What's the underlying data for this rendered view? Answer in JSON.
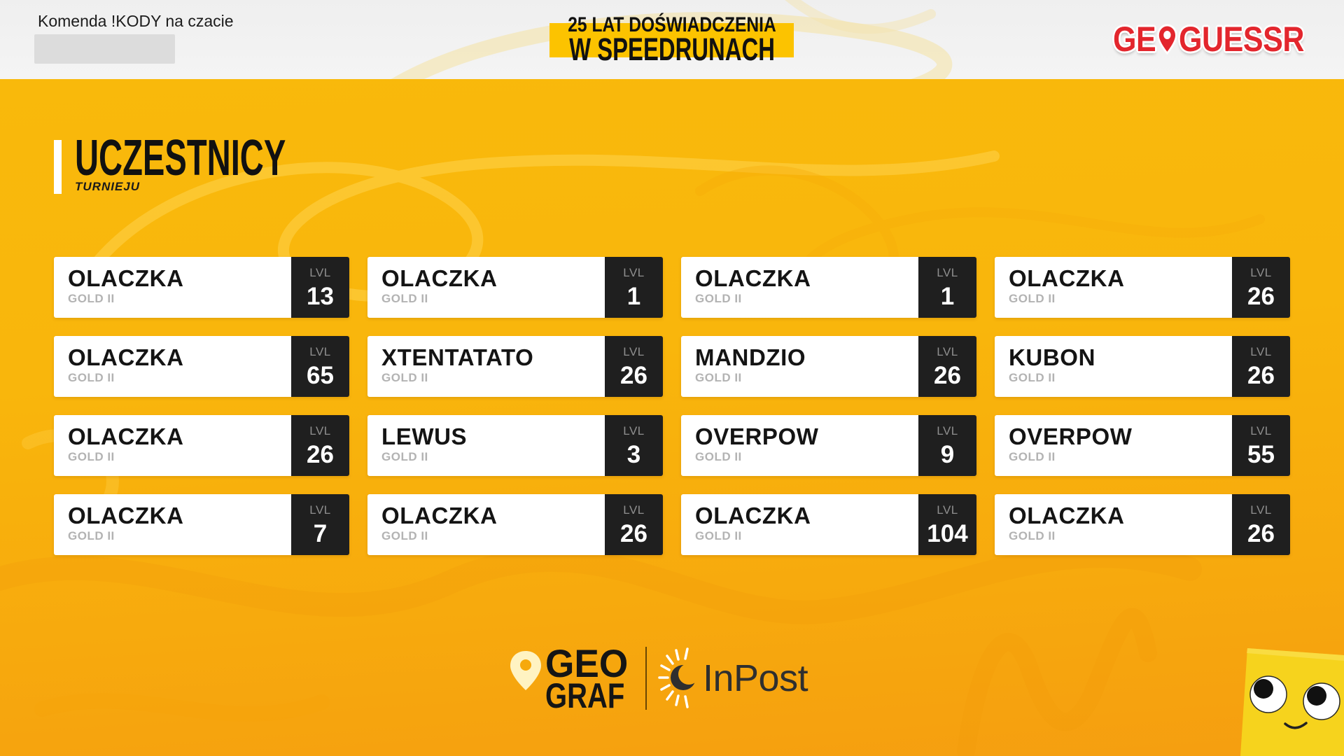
{
  "top_bar": {
    "chat_command": "Komenda !KODY na czacie",
    "banner": {
      "line1": "25 LAT DOŚWIADCZENIA",
      "line2": "W SPEEDRUNACH"
    },
    "brand_logo": {
      "left": "GE",
      "icon": "location-pin-icon",
      "right": "GUESSR"
    }
  },
  "section": {
    "title": "UCZESTNICY",
    "subtitle": "TURNIEJU"
  },
  "participants": [
    {
      "name": "OLACZKA",
      "rank": "GOLD II",
      "level_label": "LVL",
      "level": 13
    },
    {
      "name": "OLACZKA",
      "rank": "GOLD II",
      "level_label": "LVL",
      "level": 1
    },
    {
      "name": "OLACZKA",
      "rank": "GOLD II",
      "level_label": "LVL",
      "level": 1
    },
    {
      "name": "OLACZKA",
      "rank": "GOLD II",
      "level_label": "LVL",
      "level": 26
    },
    {
      "name": "OLACZKA",
      "rank": "GOLD II",
      "level_label": "LVL",
      "level": 65
    },
    {
      "name": "XTENTATATO",
      "rank": "GOLD II",
      "level_label": "LVL",
      "level": 26
    },
    {
      "name": "MANDZIO",
      "rank": "GOLD II",
      "level_label": "LVL",
      "level": 26
    },
    {
      "name": "KUBON",
      "rank": "GOLD II",
      "level_label": "LVL",
      "level": 26
    },
    {
      "name": "OLACZKA",
      "rank": "GOLD II",
      "level_label": "LVL",
      "level": 26
    },
    {
      "name": "LEWUS",
      "rank": "GOLD II",
      "level_label": "LVL",
      "level": 3
    },
    {
      "name": "OVERPOW",
      "rank": "GOLD II",
      "level_label": "LVL",
      "level": 9
    },
    {
      "name": "OVERPOW",
      "rank": "GOLD II",
      "level_label": "LVL",
      "level": 55
    },
    {
      "name": "OLACZKA",
      "rank": "GOLD II",
      "level_label": "LVL",
      "level": 7
    },
    {
      "name": "OLACZKA",
      "rank": "GOLD II",
      "level_label": "LVL",
      "level": 26
    },
    {
      "name": "OLACZKA",
      "rank": "GOLD II",
      "level_label": "LVL",
      "level": 104
    },
    {
      "name": "OLACZKA",
      "rank": "GOLD II",
      "level_label": "LVL",
      "level": 26
    }
  ],
  "sponsors": {
    "geograf": {
      "icon": "map-pin-icon",
      "line1": "GEO",
      "line2": "GRAF"
    },
    "inpost": {
      "icon": "sun-moon-icon",
      "name": "InPost"
    }
  },
  "mascot": {
    "icon": "googly-eyes-mascot-icon"
  },
  "colors": {
    "main_yellow": "#f9b90b",
    "main_orange": "#f59e10",
    "top_bar_gray": "#efefef",
    "banner_yellow": "#fcc300",
    "brand_red": "#e3262d",
    "card_white": "#ffffff",
    "level_box_dark": "#1f1f1f",
    "rank_gray": "#b3b3b3",
    "text_dark": "#111111"
  }
}
